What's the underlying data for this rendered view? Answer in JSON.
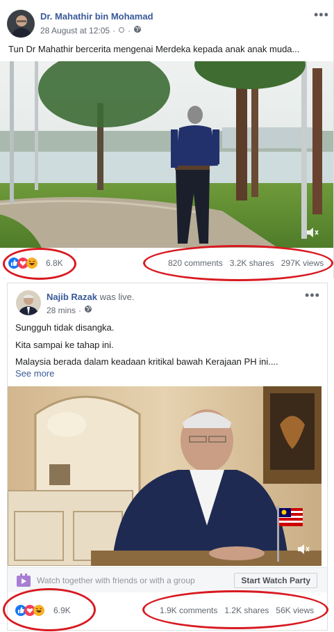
{
  "post1": {
    "author": "Dr. Mahathir bin Mohamad",
    "timestamp": "28 August at 12:05",
    "text": "Tun Dr Mahathir bercerita mengenai Merdeka kepada anak anak muda...",
    "reaction_count": "6.8K",
    "comments": "820 comments",
    "shares": "3.2K shares",
    "views": "297K views"
  },
  "post2": {
    "author": "Najib Razak",
    "author_suffix": " was live.",
    "timestamp": "28 mins",
    "lines": [
      "Sungguh tidak disangka.",
      "Kita sampai ke tahap ini.",
      "Malaysia berada dalam keadaan kritikal bawah Kerajaan PH ini...."
    ],
    "see_more": "See more",
    "watch_text": "Watch together with friends or with a group",
    "watch_button": "Start Watch Party",
    "reaction_count": "6.9K",
    "comments": "1.9K comments",
    "shares": "1.2K shares",
    "views": "56K views"
  },
  "colors": {
    "link": "#385898",
    "annotation_red": "#d81920",
    "like_blue": "#1877f2",
    "love_red": "#f33e58",
    "haha_yellow": "#f7b125"
  },
  "icons": [
    "globe-icon",
    "more-options-icon",
    "like-icon",
    "love-icon",
    "haha-icon",
    "mute-icon",
    "watch-party-icon"
  ]
}
